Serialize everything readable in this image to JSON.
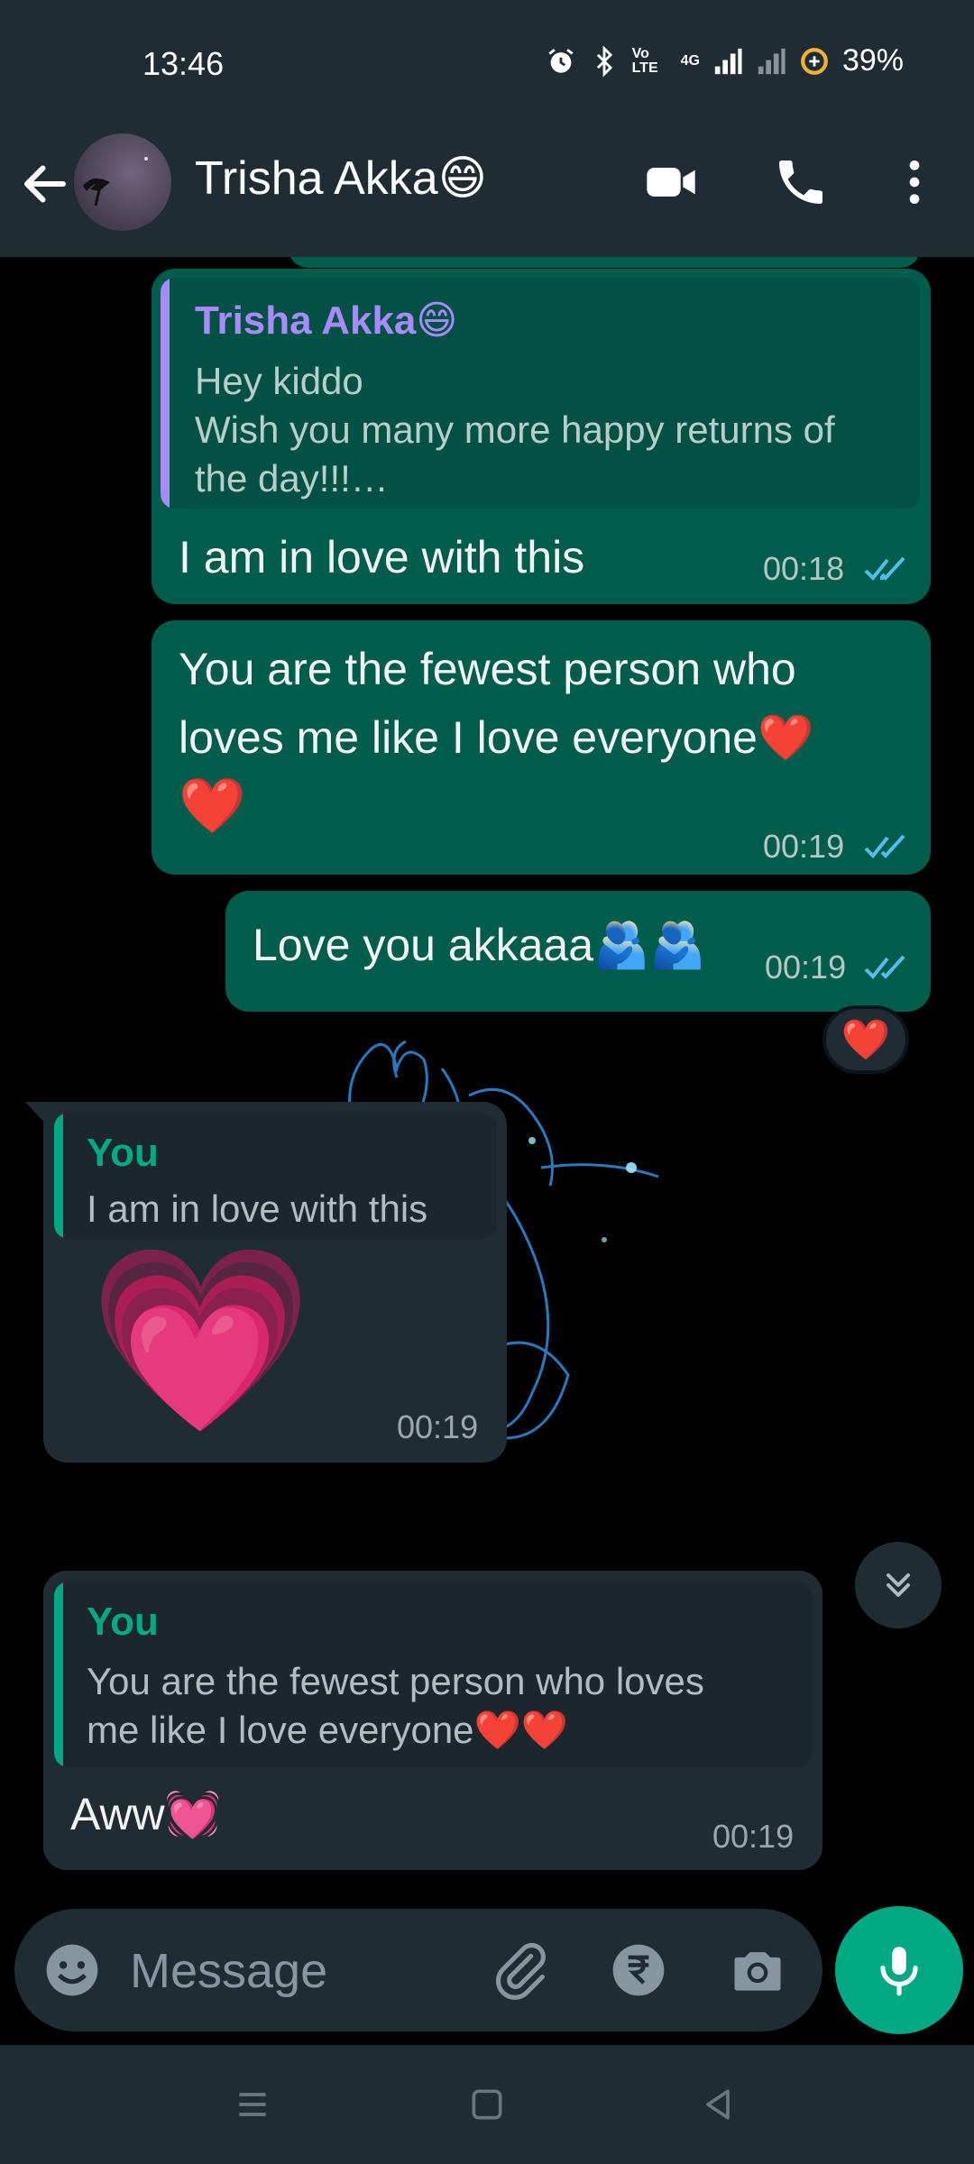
{
  "status_bar": {
    "time": "13:46",
    "battery": "39%",
    "network": "4G",
    "volte": "Vo LTE"
  },
  "header": {
    "contact_name": "Trisha Akka😄",
    "icons": [
      "back-arrow-icon",
      "video-call-icon",
      "voice-call-icon",
      "more-options-icon"
    ]
  },
  "messages": [
    {
      "direction": "out",
      "quote": {
        "author": "Trisha Akka😄",
        "lines": [
          "Hey kiddo",
          "Wish you many more happy returns of",
          "the day!!!…"
        ]
      },
      "text": "I am in love with this",
      "time": "00:18",
      "status": "read"
    },
    {
      "direction": "out",
      "lines": [
        "You are the fewest person who",
        "loves me like I love everyone❤️",
        "❤️"
      ],
      "time": "00:19",
      "status": "read"
    },
    {
      "direction": "out",
      "text": "Love you akkaaa🫂🫂",
      "time": "00:19",
      "status": "read",
      "reaction": "❤️"
    },
    {
      "direction": "in",
      "quote": {
        "author": "You",
        "lines": [
          "I am in love with this"
        ]
      },
      "text": "💗",
      "time": "00:19"
    },
    {
      "direction": "in",
      "quote": {
        "author": "You",
        "lines": [
          "You are the fewest person who loves",
          "me like I love everyone❤️❤️"
        ]
      },
      "text": "Aww💓",
      "time": "00:19"
    }
  ],
  "composer": {
    "placeholder": "Message",
    "icons": [
      "emoji-icon",
      "attach-icon",
      "rupee-payment-icon",
      "camera-icon",
      "microphone-icon"
    ]
  },
  "colors": {
    "outgoing_bubble": "#005c4b",
    "incoming_bubble": "#202c33",
    "quote_author_purple": "#a78bfa",
    "quote_author_green": "#00a884",
    "read_tick": "#53bdeb",
    "accent": "#00a884"
  }
}
